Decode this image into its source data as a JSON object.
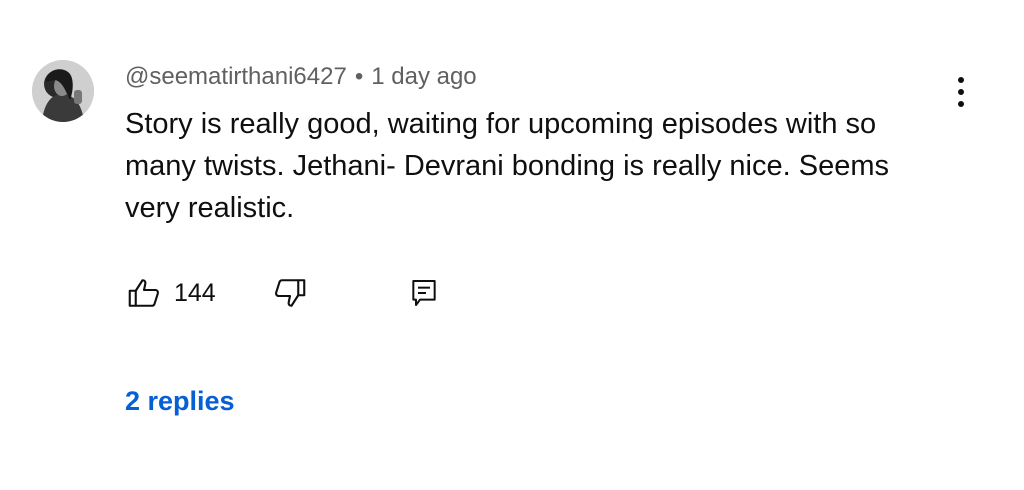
{
  "comment": {
    "author": "@seematirthani6427",
    "separator": "•",
    "time": "1 day ago",
    "text": "Story is really good, waiting for upcoming episodes with so many twists. Jethani- Devrani bonding is really nice. Seems very realistic.",
    "like_count": "144",
    "replies_label": "2 replies"
  },
  "icons": {
    "avatar": "avatar",
    "more": "more-vert-icon",
    "like": "thumbs-up-icon",
    "dislike": "thumbs-down-icon",
    "reply": "reply-icon"
  },
  "colors": {
    "text": "#0f0f0f",
    "meta": "#606060",
    "link": "#065fd4",
    "background": "#ffffff"
  }
}
